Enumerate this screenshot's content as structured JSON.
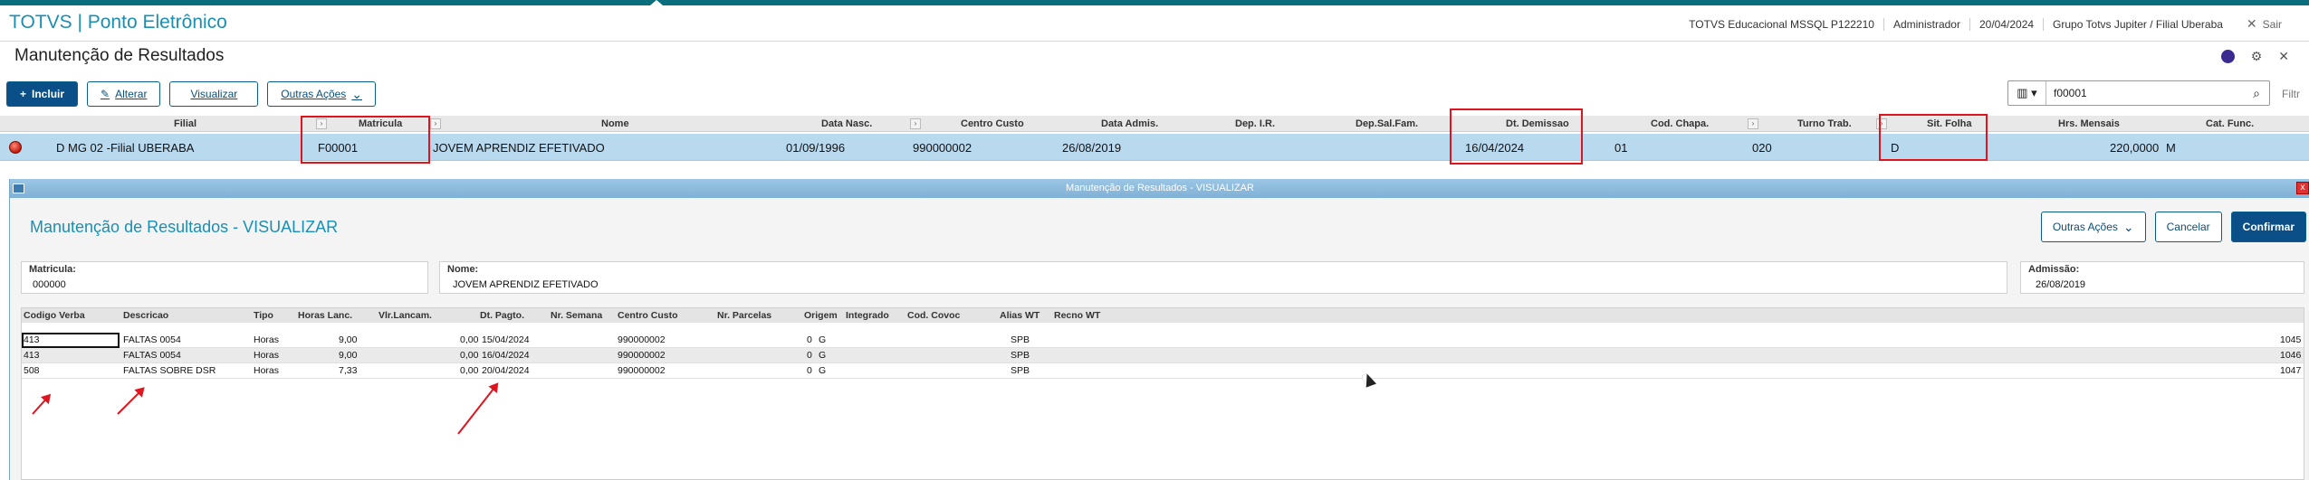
{
  "app": {
    "title": "TOTVS | Ponto Eletrônico",
    "environment": "TOTVS Educacional MSSQL P122210",
    "user": "Administrador",
    "date": "20/04/2024",
    "company": "Grupo Totvs Jupiter / Filial Uberaba",
    "exit_label": "Sair"
  },
  "page": {
    "title": "Manutenção de Resultados"
  },
  "toolbar": {
    "incluir": "Incluir",
    "alterar": "Alterar",
    "visualizar": "Visualizar",
    "outras_acoes": "Outras Ações"
  },
  "search": {
    "value": "f00001",
    "filter_label": "Filtr"
  },
  "browse": {
    "columns": [
      "Filial",
      "Matricula",
      "Nome",
      "Data Nasc.",
      "Centro Custo",
      "Data Admis.",
      "Dep. I.R.",
      "Dep.Sal.Fam.",
      "Dt. Demissao",
      "Cod. Chapa.",
      "Turno Trab.",
      "Sit. Folha",
      "Hrs. Mensais",
      "Cat. Func."
    ],
    "row": {
      "filial": "D MG 02 -Filial UBERABA",
      "matricula": "F00001",
      "nome": "JOVEM APRENDIZ EFETIVADO",
      "data_nasc": "01/09/1996",
      "centro_custo": "990000002",
      "data_admis": "26/08/2019",
      "dt_demissao": "16/04/2024",
      "cod_chapa": "01",
      "turno": "020",
      "sit_folha": "D",
      "hrs_mensais": "220,0000",
      "cat_func": "M"
    }
  },
  "dialog": {
    "window_title": "Manutenção de Resultados - VISUALIZAR",
    "heading": "Manutenção de Resultados - VISUALIZAR",
    "buttons": {
      "outras_acoes": "Outras Ações",
      "cancelar": "Cancelar",
      "confirmar": "Confirmar"
    },
    "fields": {
      "matricula_label": "Matricula:",
      "matricula_value": "000000",
      "nome_label": "Nome:",
      "nome_value": "JOVEM APRENDIZ EFETIVADO",
      "admissao_label": "Admissão:",
      "admissao_value": "26/08/2019"
    },
    "grid_columns": [
      "Codigo Verba",
      "Descricao",
      "Tipo",
      "Horas Lanc.",
      "Vlr.Lancam.",
      "Dt. Pagto.",
      "Nr. Semana",
      "Centro Custo",
      "Nr. Parcelas",
      "Origem",
      "Integrado",
      "Cod. Covoc",
      "Alias WT",
      "Recno WT"
    ],
    "rows": [
      {
        "verba": "413",
        "descricao": "FALTAS 0054",
        "tipo": "Horas",
        "horas": "9,00",
        "valor": "0,00",
        "dt_pagto": "15/04/2024",
        "centro": "990000002",
        "parcelas": "0",
        "origem": "G",
        "alias": "SPB",
        "recno": "1045"
      },
      {
        "verba": "413",
        "descricao": "FALTAS 0054",
        "tipo": "Horas",
        "horas": "9,00",
        "valor": "0,00",
        "dt_pagto": "16/04/2024",
        "centro": "990000002",
        "parcelas": "0",
        "origem": "G",
        "alias": "SPB",
        "recno": "1046"
      },
      {
        "verba": "508",
        "descricao": "FALTAS SOBRE DSR",
        "tipo": "Horas",
        "horas": "7,33",
        "valor": "0,00",
        "dt_pagto": "20/04/2024",
        "centro": "990000002",
        "parcelas": "0",
        "origem": "G",
        "alias": "SPB",
        "recno": "1047"
      }
    ]
  },
  "colors": {
    "brand_teal": "#0b6e7d",
    "title_blue": "#1a8fb3",
    "selected_row": "#b9d9ef",
    "annotation_red": "#e0141e"
  }
}
